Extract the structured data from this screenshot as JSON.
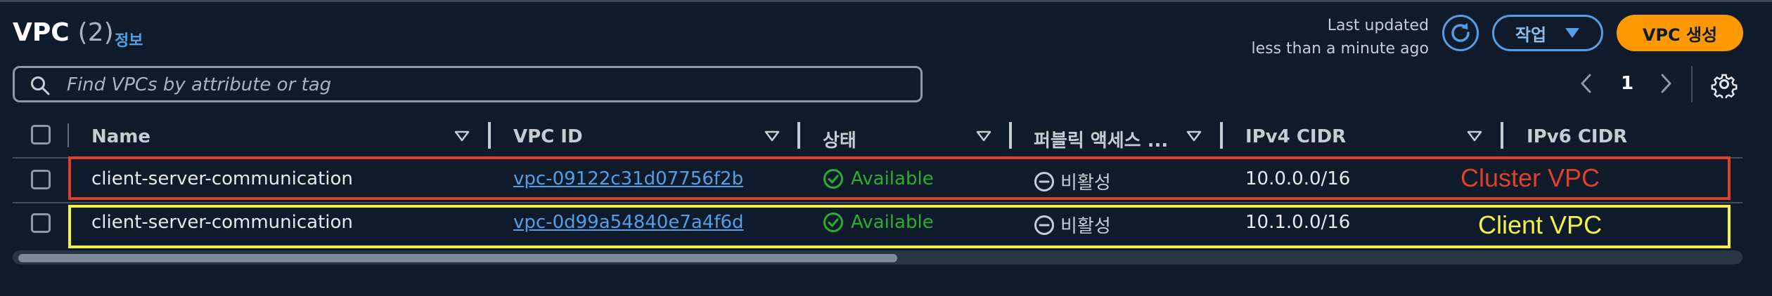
{
  "header": {
    "title": "VPC",
    "count": "(2)",
    "info_link": "정보",
    "last_updated_line1": "Last updated",
    "last_updated_line2": "less than a minute ago",
    "refresh_icon": "refresh-icon",
    "actions_label": "작업",
    "create_label": "VPC 생성"
  },
  "search": {
    "placeholder": "Find VPCs by attribute or tag",
    "value": ""
  },
  "pagination": {
    "current_page": "1"
  },
  "table": {
    "columns": [
      "Name",
      "VPC ID",
      "상태",
      "퍼블릭 액세스 ...",
      "IPv4 CIDR",
      "IPv6 CIDR"
    ],
    "rows": [
      {
        "name": "client-server-communication",
        "vpc_id": "vpc-09122c31d07756f2b",
        "status": "Available",
        "public_access": "비활성",
        "ipv4_cidr": "10.0.0.0/16",
        "ipv6_cidr": ""
      },
      {
        "name": "client-server-communication",
        "vpc_id": "vpc-0d99a54840e7a4f6d",
        "status": "Available",
        "public_access": "비활성",
        "ipv4_cidr": "10.1.0.0/16",
        "ipv6_cidr": ""
      }
    ]
  },
  "annotations": {
    "cluster": "Cluster VPC",
    "client": "Client VPC"
  },
  "colors": {
    "background": "#0f1b2a",
    "accent_blue": "#539fe5",
    "primary_orange": "#ff9900",
    "status_green": "#29ad32",
    "annotation_red": "#e0402a",
    "annotation_yellow": "#f2f24a"
  }
}
